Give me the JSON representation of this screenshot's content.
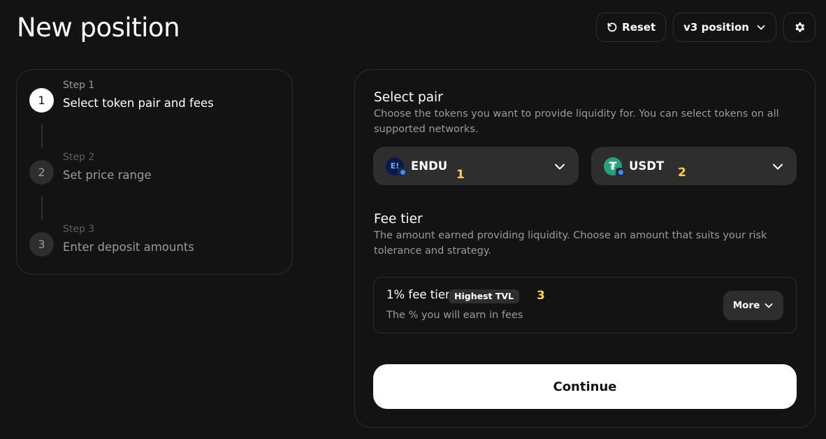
{
  "page": {
    "title": "New position"
  },
  "header": {
    "reset_label": "Reset",
    "version_label": "v3 position",
    "reset_icon": "reset-icon",
    "settings_icon": "gear-icon"
  },
  "steps": [
    {
      "number": "1",
      "label": "Step 1",
      "name": "Select token pair and fees",
      "active": true
    },
    {
      "number": "2",
      "label": "Step 2",
      "name": "Set price range",
      "active": false
    },
    {
      "number": "3",
      "label": "Step 3",
      "name": "Enter deposit amounts",
      "active": false
    }
  ],
  "select_pair": {
    "title": "Select pair",
    "description": "Choose the tokens you want to provide liquidity for. You can select tokens on all supported networks.",
    "token_a": {
      "symbol": "ENDU",
      "icon_text": "E!",
      "marker": "1",
      "icon_color": "#0b1a4a"
    },
    "token_b": {
      "symbol": "USDT",
      "icon_text": "₮",
      "marker": "2",
      "icon_color": "#26a17b"
    }
  },
  "fee_tier": {
    "title": "Fee tier",
    "description": "The amount earned providing liquidity. Choose an amount that suits your risk tolerance and strategy.",
    "selected": "1% fee tier",
    "badge": "Highest TVL",
    "subtitle": "The % you will earn in fees",
    "more_label": "More",
    "marker": "3"
  },
  "continue_label": "Continue",
  "colors": {
    "background": "#131313",
    "surface": "#2e2e2e",
    "marker": "#f9d34b"
  }
}
